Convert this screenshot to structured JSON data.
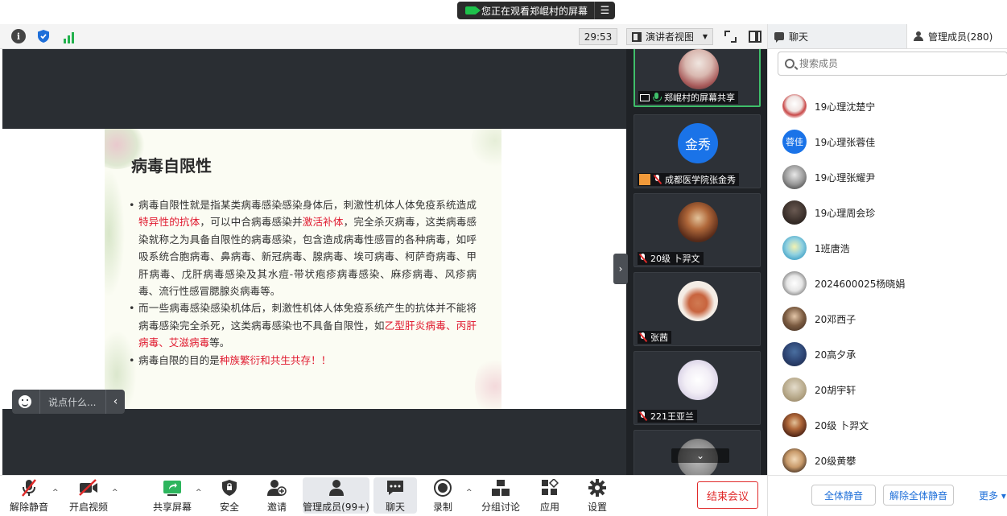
{
  "banner": {
    "text": "您正在观看郑崐村的屏幕",
    "menu_icon": "menu-lines-icon"
  },
  "topbar": {
    "timer": "29:53",
    "view_label": "演讲者视图"
  },
  "slide": {
    "title": "病毒自限性",
    "p1": {
      "t1": "病毒自限性就是指某类病毒感染感染身体后，刺激性机体人体免疫系统造成",
      "r1": "特异性的抗体",
      "t2": "，可以中合病毒感染并",
      "r2": "激活补体",
      "t3": "，完全杀灭病毒，这类病毒感染就称之为具备自限性的病毒感染，包含造成病毒性感冒的各种病毒，如呼吸系统合胞病毒、鼻病毒、新冠病毒、腺病毒、埃可病毒、柯萨奇病毒、甲肝病毒、戊肝病毒感染及其水痘-带状疱疹病毒感染、麻疹病毒、风疹病毒、流行性感冒腮腺炎病毒等。"
    },
    "p2": {
      "t1": "而一些病毒感染感染机体后，刺激性机体人体免疫系统产生的抗体并不能将病毒感染完全杀死，这类病毒感染也不具备自限性，如",
      "r1": "乙型肝炎病毒、丙肝病毒、艾滋病毒",
      "t2": "等。"
    },
    "p3": {
      "t1": "病毒自限的目的是",
      "r1": "种族繁衍和共生共存！！"
    }
  },
  "comment": {
    "placeholder": "说点什么..."
  },
  "gallery": {
    "tiles": [
      {
        "name": "郑崐村的屏幕共享"
      },
      {
        "name": "成都医学院张金秀",
        "avatar_text": "金秀"
      },
      {
        "name": "20级 卜羿文"
      },
      {
        "name": "张茜"
      },
      {
        "name": "221王亚兰"
      }
    ]
  },
  "bottombar": {
    "unmute": "解除静音",
    "video": "开启视频",
    "share": "共享屏幕",
    "security": "安全",
    "invite": "邀请",
    "manage": "管理成员(99+)",
    "chat": "聊天",
    "record": "录制",
    "breakout": "分组讨论",
    "apps": "应用",
    "settings": "设置",
    "end": "结束会议"
  },
  "rpanel": {
    "tab_chat": "聊天",
    "tab_members": "管理成员(280)",
    "search_placeholder": "搜索成员",
    "members": [
      {
        "name": "19心理沈楚宁"
      },
      {
        "name": "19心理张蓉佳",
        "avatar_text": "蓉佳"
      },
      {
        "name": "19心理张耀尹"
      },
      {
        "name": "19心理周会珍"
      },
      {
        "name": "1班唐浩"
      },
      {
        "name": "2024600025杨晓娟"
      },
      {
        "name": "20邓西子"
      },
      {
        "name": "20高夕承"
      },
      {
        "name": "20胡宇轩"
      },
      {
        "name": "20级 卜羿文"
      },
      {
        "name": "20级黄攀"
      }
    ],
    "mute_all": "全体静音",
    "unmute_all": "解除全体静音",
    "more": "更多"
  },
  "colors": {
    "accent": "#1e6fd9",
    "danger": "#e02a2a",
    "active": "#3fbf6a",
    "slide_red": "#e0192e"
  }
}
